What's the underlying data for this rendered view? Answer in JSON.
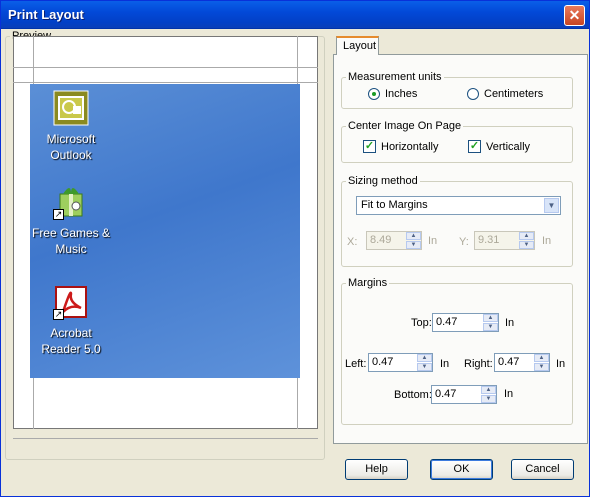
{
  "window": {
    "title": "Print Layout",
    "close_glyph": "✕"
  },
  "preview": {
    "legend": "Preview",
    "icons": [
      {
        "label_line1": "Microsoft",
        "label_line2": "Outlook",
        "icon": "outlook-icon"
      },
      {
        "label_line1": "Free Games &",
        "label_line2": "Music",
        "icon": "games-icon"
      },
      {
        "label_line1": "Acrobat",
        "label_line2": "Reader 5.0",
        "icon": "acrobat-icon"
      }
    ],
    "shortcut_glyph": "↗"
  },
  "tabs": [
    {
      "label": "Layout",
      "selected": true
    }
  ],
  "measurement": {
    "legend": "Measurement units",
    "inches_label": "Inches",
    "centimeters_label": "Centimeters",
    "selected": "inches"
  },
  "center": {
    "legend": "Center Image On Page",
    "horizontally_label": "Horizontally",
    "vertically_label": "Vertically",
    "horizontally_checked": true,
    "vertically_checked": true,
    "check_glyph": "✓"
  },
  "sizing": {
    "legend": "Sizing method",
    "selected_value": "Fit to Margins",
    "x_label": "X:",
    "x_value": "8.49",
    "y_label": "Y:",
    "y_value": "9.31",
    "unit": "In"
  },
  "margins": {
    "legend": "Margins",
    "top_label": "Top:",
    "top_value": "0.47",
    "left_label": "Left:",
    "left_value": "0.47",
    "right_label": "Right:",
    "right_value": "0.47",
    "bottom_label": "Bottom:",
    "bottom_value": "0.47",
    "unit": "In"
  },
  "buttons": {
    "help": "Help",
    "ok": "OK",
    "cancel": "Cancel"
  },
  "colors": {
    "titlebar": "#0249d8",
    "desktop": "#3f77cc",
    "face": "#ece9d8"
  }
}
